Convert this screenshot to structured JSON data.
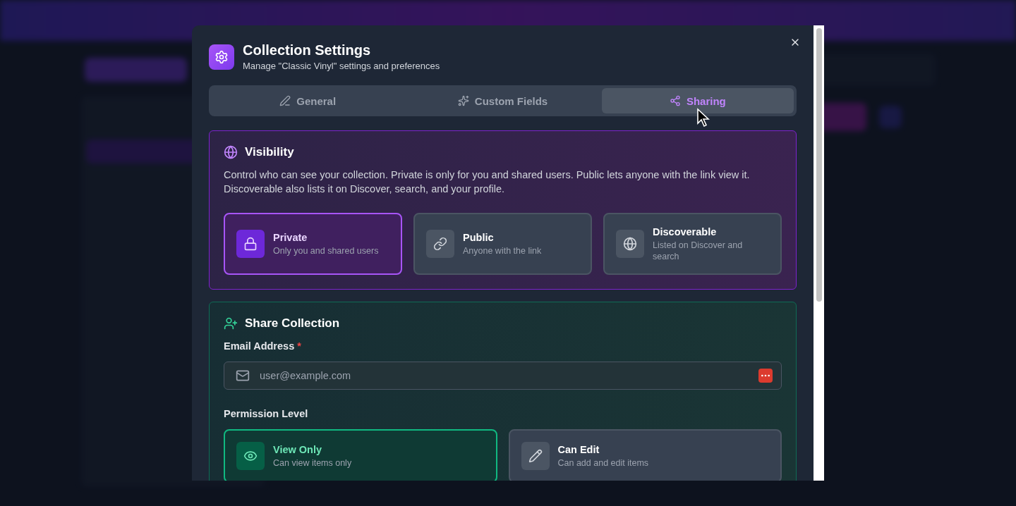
{
  "dialog": {
    "title": "Collection Settings",
    "subtitle": "Manage \"Classic Vinyl\" settings and preferences"
  },
  "tabs": [
    {
      "label": "General",
      "selected": false
    },
    {
      "label": "Custom Fields",
      "selected": false
    },
    {
      "label": "Sharing",
      "selected": true
    }
  ],
  "visibility": {
    "title": "Visibility",
    "description": "Control who can see your collection. Private is only for you and shared users. Public lets anyone with the link view it. Discoverable also lists it on Discover, search, and your profile.",
    "options": [
      {
        "title": "Private",
        "description": "Only you and shared users",
        "selected": true
      },
      {
        "title": "Public",
        "description": "Anyone with the link",
        "selected": false
      },
      {
        "title": "Discoverable",
        "description": "Listed on Discover and search",
        "selected": false
      }
    ]
  },
  "share": {
    "title": "Share Collection",
    "email": {
      "label": "Email Address",
      "required_mark": "*",
      "placeholder": "user@example.com"
    },
    "permission": {
      "label": "Permission Level",
      "options": [
        {
          "title": "View Only",
          "description": "Can view items only",
          "selected": true
        },
        {
          "title": "Can Edit",
          "description": "Can add and edit items",
          "selected": false
        }
      ]
    }
  }
}
